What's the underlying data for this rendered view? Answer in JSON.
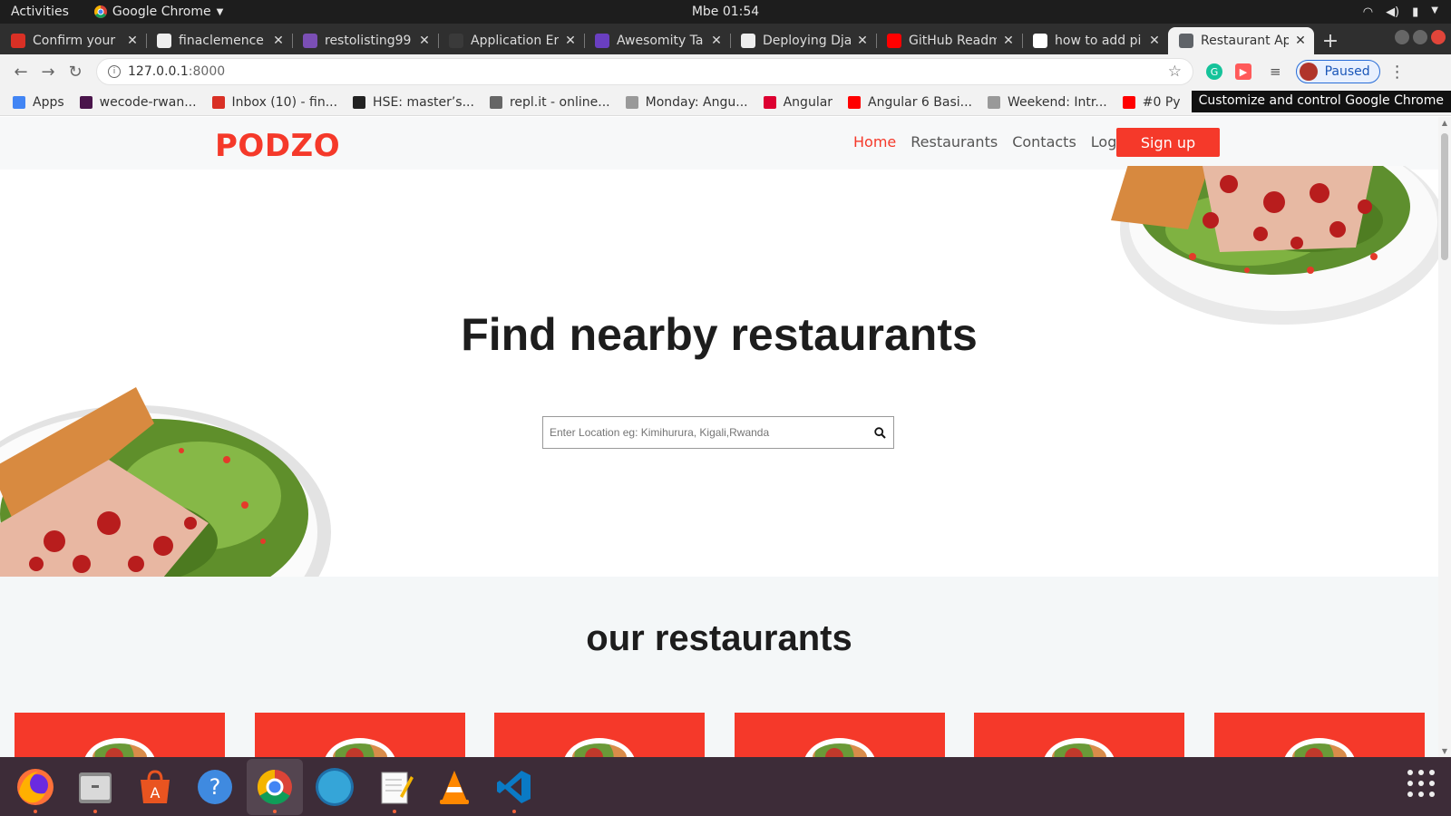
{
  "system": {
    "activities": "Activities",
    "app_name": "Google Chrome",
    "clock": "Mbe 01:54"
  },
  "tabs": [
    {
      "title": "Confirm your",
      "favicon_color": "#d93025"
    },
    {
      "title": "finaclemence",
      "favicon_color": "#eeeeee"
    },
    {
      "title": "restolisting99",
      "favicon_color": "#7b4fb5"
    },
    {
      "title": "Application Er",
      "favicon_color": "#3a3a3a"
    },
    {
      "title": "Awesomity Ta",
      "favicon_color": "#6a3fc1"
    },
    {
      "title": "Deploying Dja",
      "favicon_color": "#eeeeee"
    },
    {
      "title": "GitHub Readm",
      "favicon_color": "#ff0000"
    },
    {
      "title": "how to add pi",
      "favicon_color": "#ffffff"
    },
    {
      "title": "Restaurant Ap",
      "favicon_color": "#5f6368",
      "active": true
    }
  ],
  "toolbar": {
    "url_host": "127.0.0.1",
    "url_port": ":8000",
    "profile_status": "Paused",
    "tooltip": "Customize and control Google Chrome"
  },
  "bookmarks": [
    {
      "label": "Apps",
      "icon": "apps-grid-icon",
      "color": "#4285f4"
    },
    {
      "label": "wecode-rwan...",
      "icon": "slack-icon",
      "color": "#4a154b"
    },
    {
      "label": "Inbox (10) - fin...",
      "icon": "gmail-icon",
      "color": "#d93025"
    },
    {
      "label": "HSE: master’s...",
      "icon": "hse-icon",
      "color": "#222222"
    },
    {
      "label": "repl.it - online...",
      "icon": "replit-icon",
      "color": "#666666"
    },
    {
      "label": "Monday: Angu...",
      "icon": "pin-icon",
      "color": "#999999"
    },
    {
      "label": "Angular",
      "icon": "angular-icon",
      "color": "#dd0031"
    },
    {
      "label": "Angular 6 Basi...",
      "icon": "youtube-icon",
      "color": "#ff0000"
    },
    {
      "label": "Weekend: Intr...",
      "icon": "pin-icon",
      "color": "#999999"
    },
    {
      "label": "#0 Py",
      "icon": "youtube-icon",
      "color": "#ff0000"
    }
  ],
  "site": {
    "brand": "PODZO",
    "brand_color": "#f5392a",
    "nav": {
      "home": "Home",
      "restaurants": "Restaurants",
      "contacts": "Contacts",
      "login": "Login",
      "signup": "Sign up"
    },
    "hero_title": "Find nearby restaurants",
    "search_placeholder": "Enter Location eg: Kimihurura, Kigali,Rwanda",
    "section_title": "our restaurants",
    "card_count": 6
  },
  "dock": [
    {
      "name": "firefox-icon",
      "running": true
    },
    {
      "name": "files-icon",
      "running": true
    },
    {
      "name": "software-center-icon",
      "running": false
    },
    {
      "name": "help-icon",
      "running": false
    },
    {
      "name": "chrome-icon",
      "running": true,
      "active": true
    },
    {
      "name": "screen-recorder-icon",
      "running": false
    },
    {
      "name": "text-editor-icon",
      "running": true
    },
    {
      "name": "vlc-icon",
      "running": false
    },
    {
      "name": "vscode-icon",
      "running": true
    }
  ]
}
